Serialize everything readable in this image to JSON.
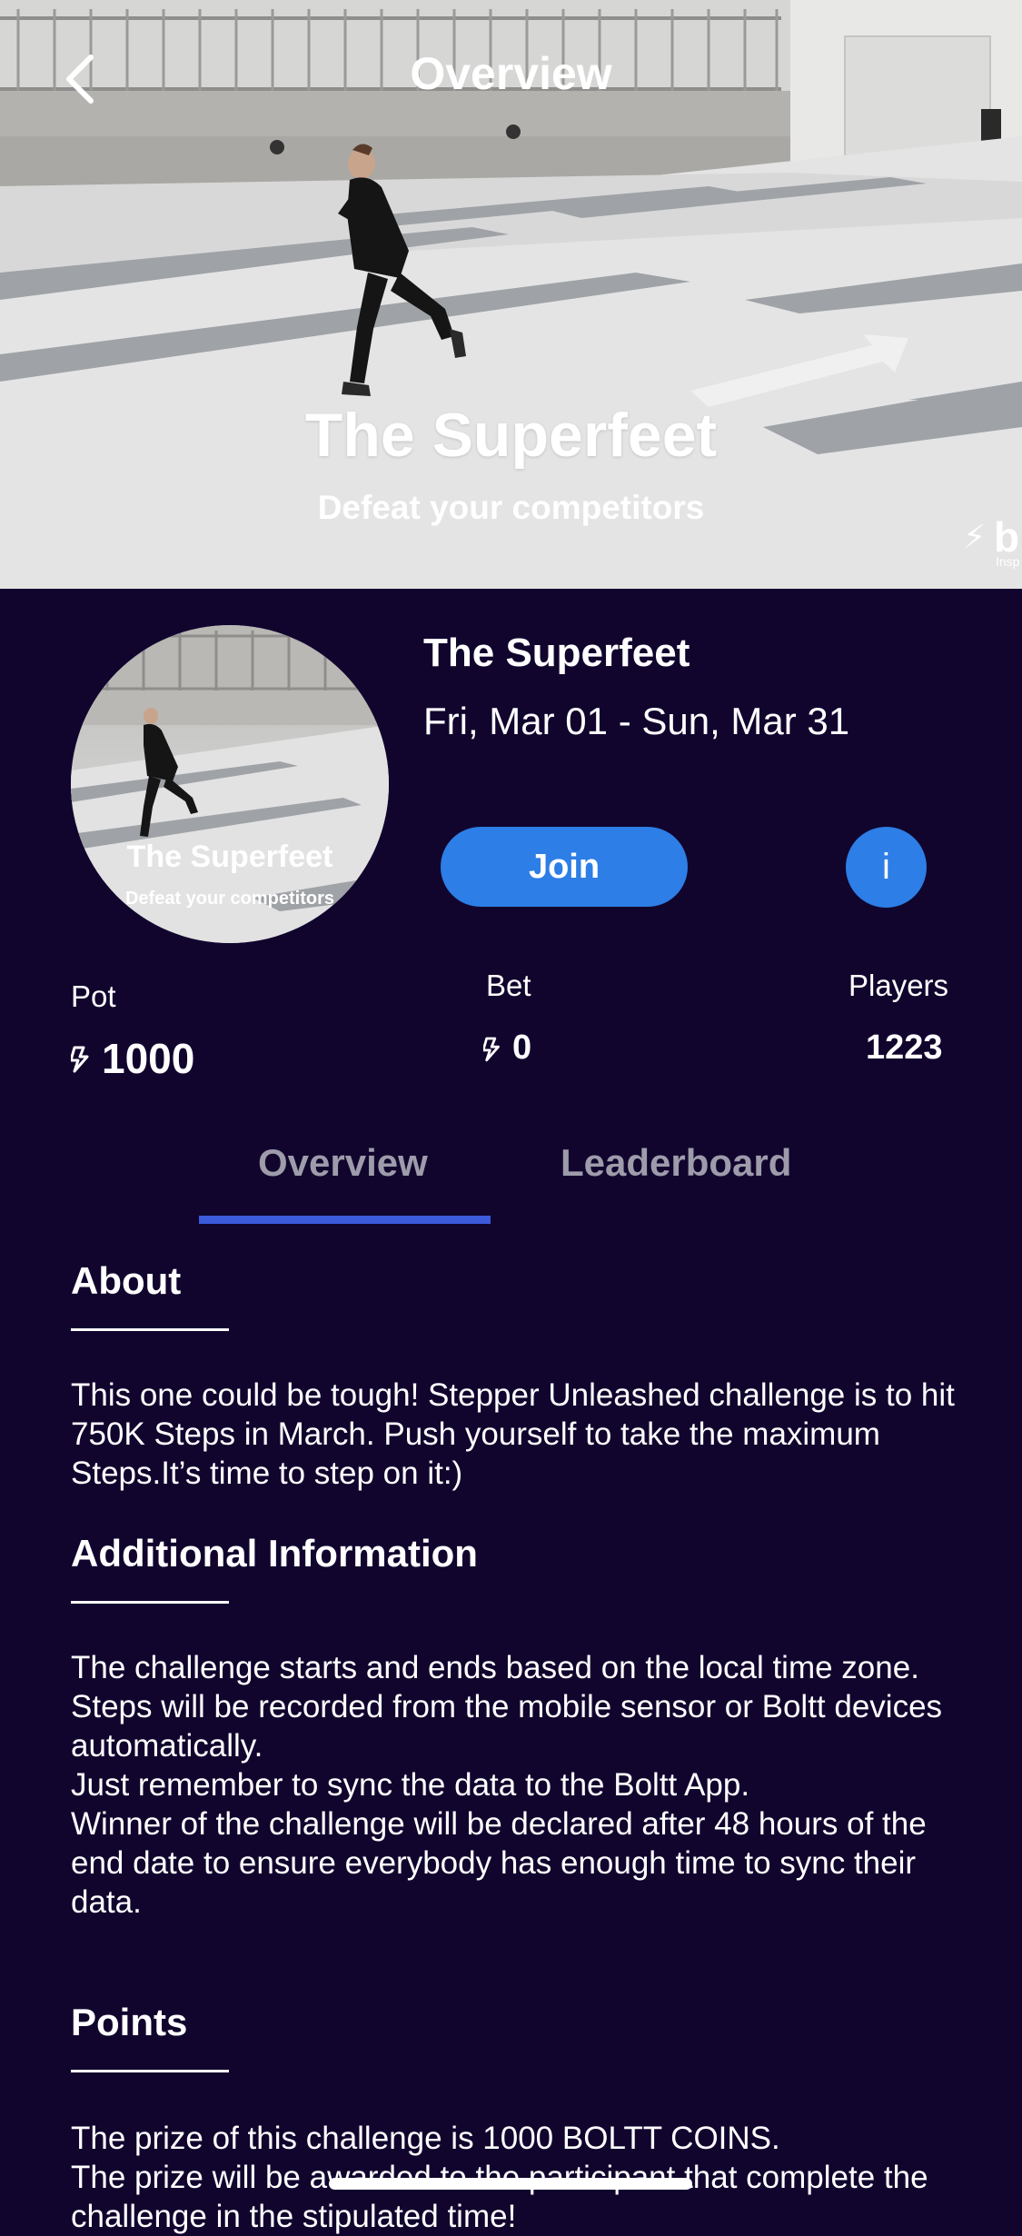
{
  "nav": {
    "title": "Overview",
    "back_icon": "chevron-left-icon"
  },
  "hero": {
    "title": "The Superfeet",
    "subtitle": "Defeat your competitors",
    "brand_letter": "b",
    "brand_tagline": "Insp"
  },
  "challenge": {
    "avatar_title": "The Superfeet",
    "avatar_subtitle": "Defeat your competitors",
    "name": "The Superfeet",
    "dates": "Fri, Mar 01 - Sun, Mar 31",
    "join_label": "Join",
    "info_label": "i"
  },
  "stats": {
    "pot_label": "Pot",
    "pot_value": "1000",
    "bet_label": "Bet",
    "bet_value": "0",
    "players_label": "Players",
    "players_value": "1223",
    "coin_icon": "boltt-coin-icon"
  },
  "tabs": [
    {
      "label": "Overview",
      "active": true
    },
    {
      "label": "Leaderboard",
      "active": false
    }
  ],
  "sections": {
    "about": {
      "heading": "About",
      "body": "This one could be tough! Stepper Unleashed challenge is to hit 750K Steps in March.  Push yourself to take the maximum Steps.It’s time to step on it:)"
    },
    "additional": {
      "heading": "Additional Information",
      "lines": [
        "The challenge starts and ends based on the local time zone.",
        "Steps will be recorded from the mobile sensor or Boltt devices automatically.",
        "Just remember to sync the data to the Boltt App.",
        "Winner of the challenge will be declared after 48 hours of the end date to ensure everybody has enough time to sync their data."
      ]
    },
    "points": {
      "heading": "Points",
      "lines": [
        "The prize of this challenge is 1000 BOLTT COINS.",
        "The prize will be awarded to the participant that complete the challenge in the stipulated time!"
      ]
    }
  },
  "colors": {
    "background": "#11052e",
    "accent": "#2d7ee6",
    "tab_underline": "#3b5bdb",
    "tab_text": "#9e9cab"
  }
}
